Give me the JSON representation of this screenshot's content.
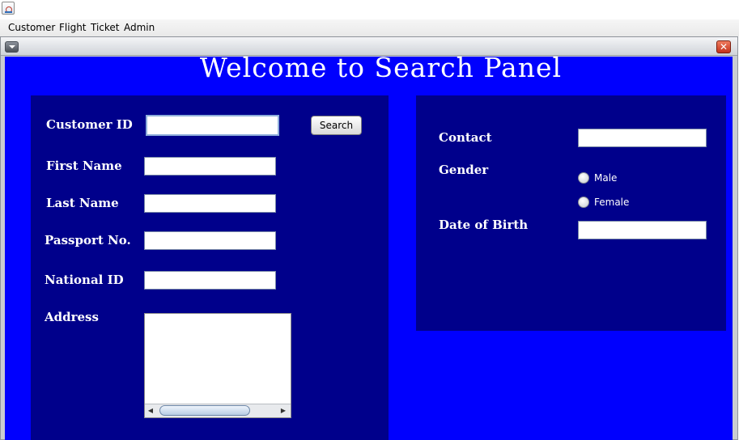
{
  "window": {
    "icon": "java-app-icon"
  },
  "menubar": {
    "items": [
      "Customer",
      "Flight",
      "Ticket",
      "Admin"
    ]
  },
  "frame": {
    "menu_icon": "chevron-down-icon",
    "close_glyph": "✕"
  },
  "page": {
    "title": "Welcome to Search Panel"
  },
  "left_panel": {
    "customer_id_label": "Customer ID",
    "customer_id_value": "",
    "search_label": "Search",
    "first_name_label": "First Name",
    "first_name_value": "",
    "last_name_label": "Last Name",
    "last_name_value": "",
    "passport_label": "Passport No.",
    "passport_value": "",
    "national_id_label": "National ID",
    "national_id_value": "",
    "address_label": "Address",
    "address_value": ""
  },
  "right_panel": {
    "contact_label": "Contact",
    "contact_value": "",
    "gender_label": "Gender",
    "gender_options": [
      "Male",
      "Female"
    ],
    "dob_label": "Date of Birth",
    "dob_value": ""
  },
  "colors": {
    "background": "#0000fe",
    "panel": "#00008b",
    "text": "#ffffff"
  }
}
